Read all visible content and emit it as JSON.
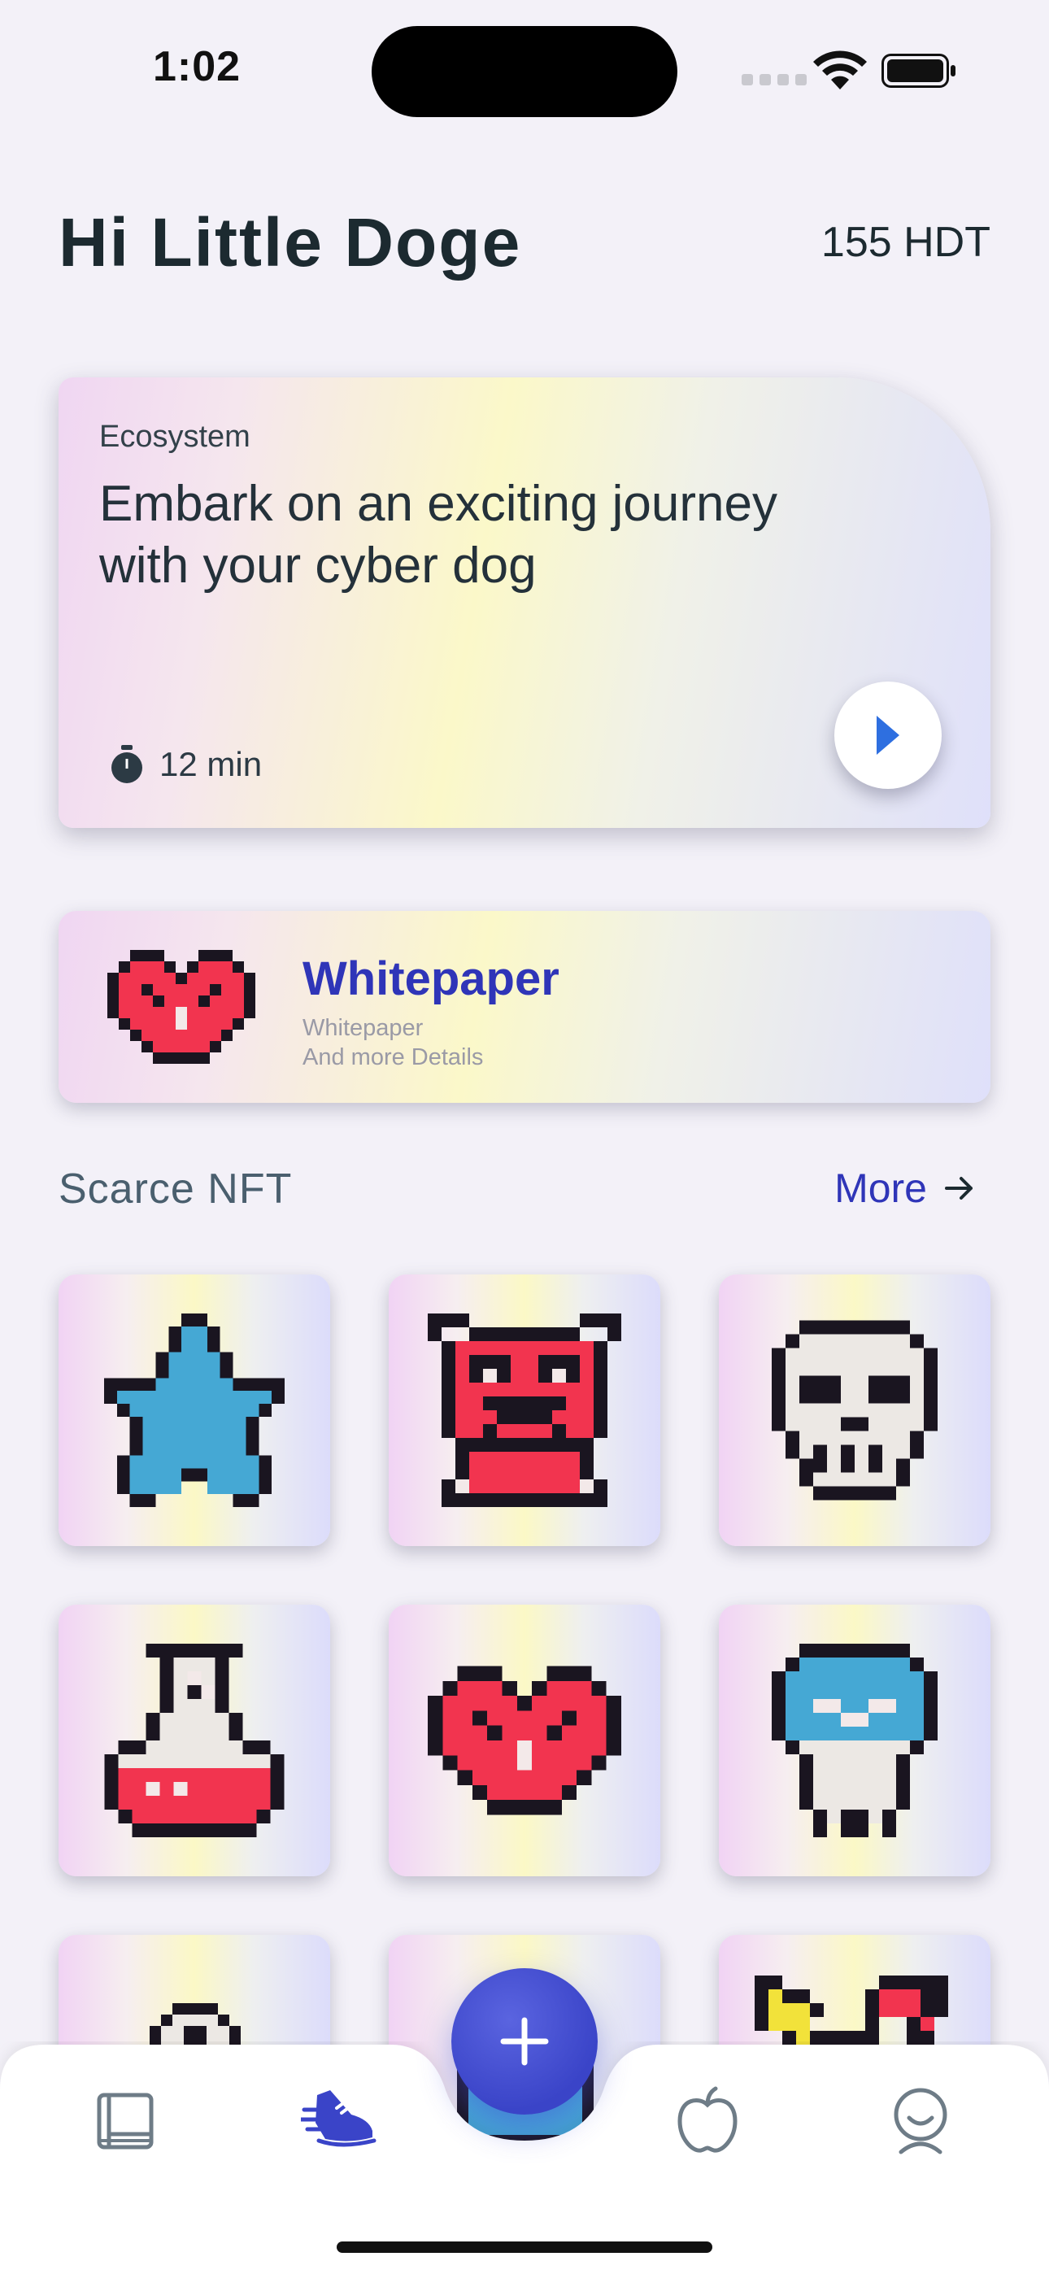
{
  "status_bar": {
    "time": "1:02"
  },
  "header": {
    "greeting": "Hi Little Doge",
    "balance": "155 HDT"
  },
  "hero": {
    "category": "Ecosystem",
    "title": "Embark on an exciting journey with your cyber dog",
    "duration": "12 min"
  },
  "whitepaper": {
    "title": "Whitepaper",
    "subtitle_line1": "Whitepaper",
    "subtitle_line2": "And more Details"
  },
  "nft_section": {
    "title": "Scarce NFT",
    "more_label": "More",
    "items": [
      "star",
      "red-bear",
      "skull",
      "potion",
      "heart",
      "ghost",
      "tombstone",
      "robot",
      "flowers"
    ]
  },
  "bottom_nav": {
    "items": [
      "book-icon",
      "sneaker-icon",
      "add-icon",
      "apple-icon",
      "profile-icon"
    ],
    "active": "sneaker-icon"
  },
  "colors": {
    "accent": "#2f35b8",
    "fab": "#3a44c8",
    "red": "#f2344f",
    "blue": "#45a8d4"
  }
}
